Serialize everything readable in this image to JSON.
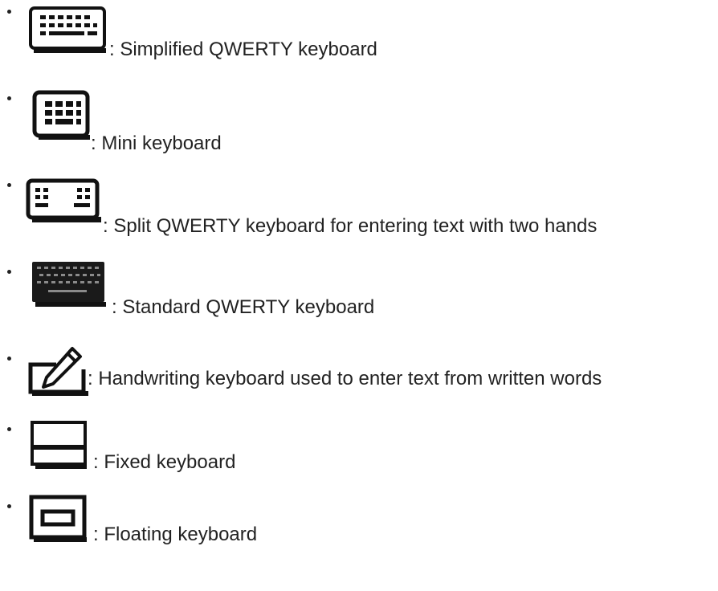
{
  "items": [
    {
      "icon": "simplified-qwerty-keyboard-icon",
      "text": ": Simplified QWERTY keyboard"
    },
    {
      "icon": "mini-keyboard-icon",
      "text": ": Mini keyboard"
    },
    {
      "icon": "split-qwerty-keyboard-icon",
      "text": ": Split QWERTY keyboard for entering text with two hands"
    },
    {
      "icon": "standard-qwerty-keyboard-icon",
      "text": ": Standard QWERTY keyboard"
    },
    {
      "icon": "handwriting-keyboard-icon",
      "text": ": Handwriting keyboard used to enter text from written words"
    },
    {
      "icon": "fixed-keyboard-icon",
      "text": ": Fixed keyboard"
    },
    {
      "icon": "floating-keyboard-icon",
      "text": ": Floating keyboard"
    }
  ]
}
